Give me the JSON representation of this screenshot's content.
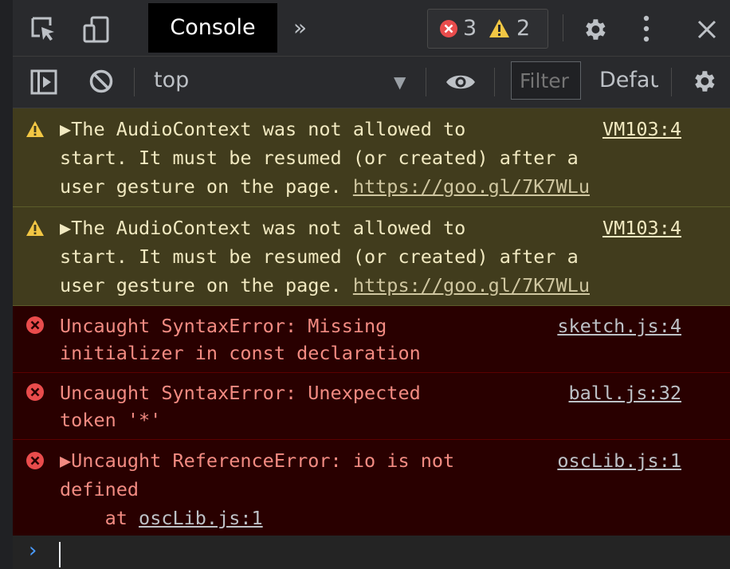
{
  "tabbar": {
    "console_tab": "Console",
    "more_tabs": "»",
    "error_count": "3",
    "warning_count": "2"
  },
  "filterbar": {
    "context": "top",
    "filter_placeholder": "Filter",
    "levels": "Defau"
  },
  "messages": [
    {
      "level": "warning",
      "line1": "▶The AudioContext was not allowed to",
      "line2": "start. It must be resumed (or created) after a",
      "line3_prefix": "user gesture on the page. ",
      "link": "https://goo.gl/7K7WLu",
      "source": "VM103:4"
    },
    {
      "level": "warning",
      "line1": "▶The AudioContext was not allowed to",
      "line2": "start. It must be resumed (or created) after a",
      "line3_prefix": "user gesture on the page. ",
      "link": "https://goo.gl/7K7WLu",
      "source": "VM103:4"
    },
    {
      "level": "error",
      "line1": "Uncaught SyntaxError: Missing",
      "line2": "initializer in const declaration",
      "source": "sketch.js:4"
    },
    {
      "level": "error",
      "line1": "Uncaught SyntaxError: Unexpected",
      "line2": "token '*'",
      "source": "ball.js:32"
    },
    {
      "level": "error",
      "line1": "▶Uncaught ReferenceError: io is not",
      "line2": "defined",
      "line3_prefix": "    at ",
      "link": "oscLib.js:1",
      "source": "oscLib.js:1"
    }
  ],
  "prompt": {
    "symbol": "›"
  },
  "colors": {
    "warning_bg": "#413c1d",
    "error_bg": "#290000",
    "error_text": "#f28b82",
    "warning_icon": "#f2c744",
    "error_icon": "#e94c4c",
    "prompt_accent": "#4a9cff"
  }
}
